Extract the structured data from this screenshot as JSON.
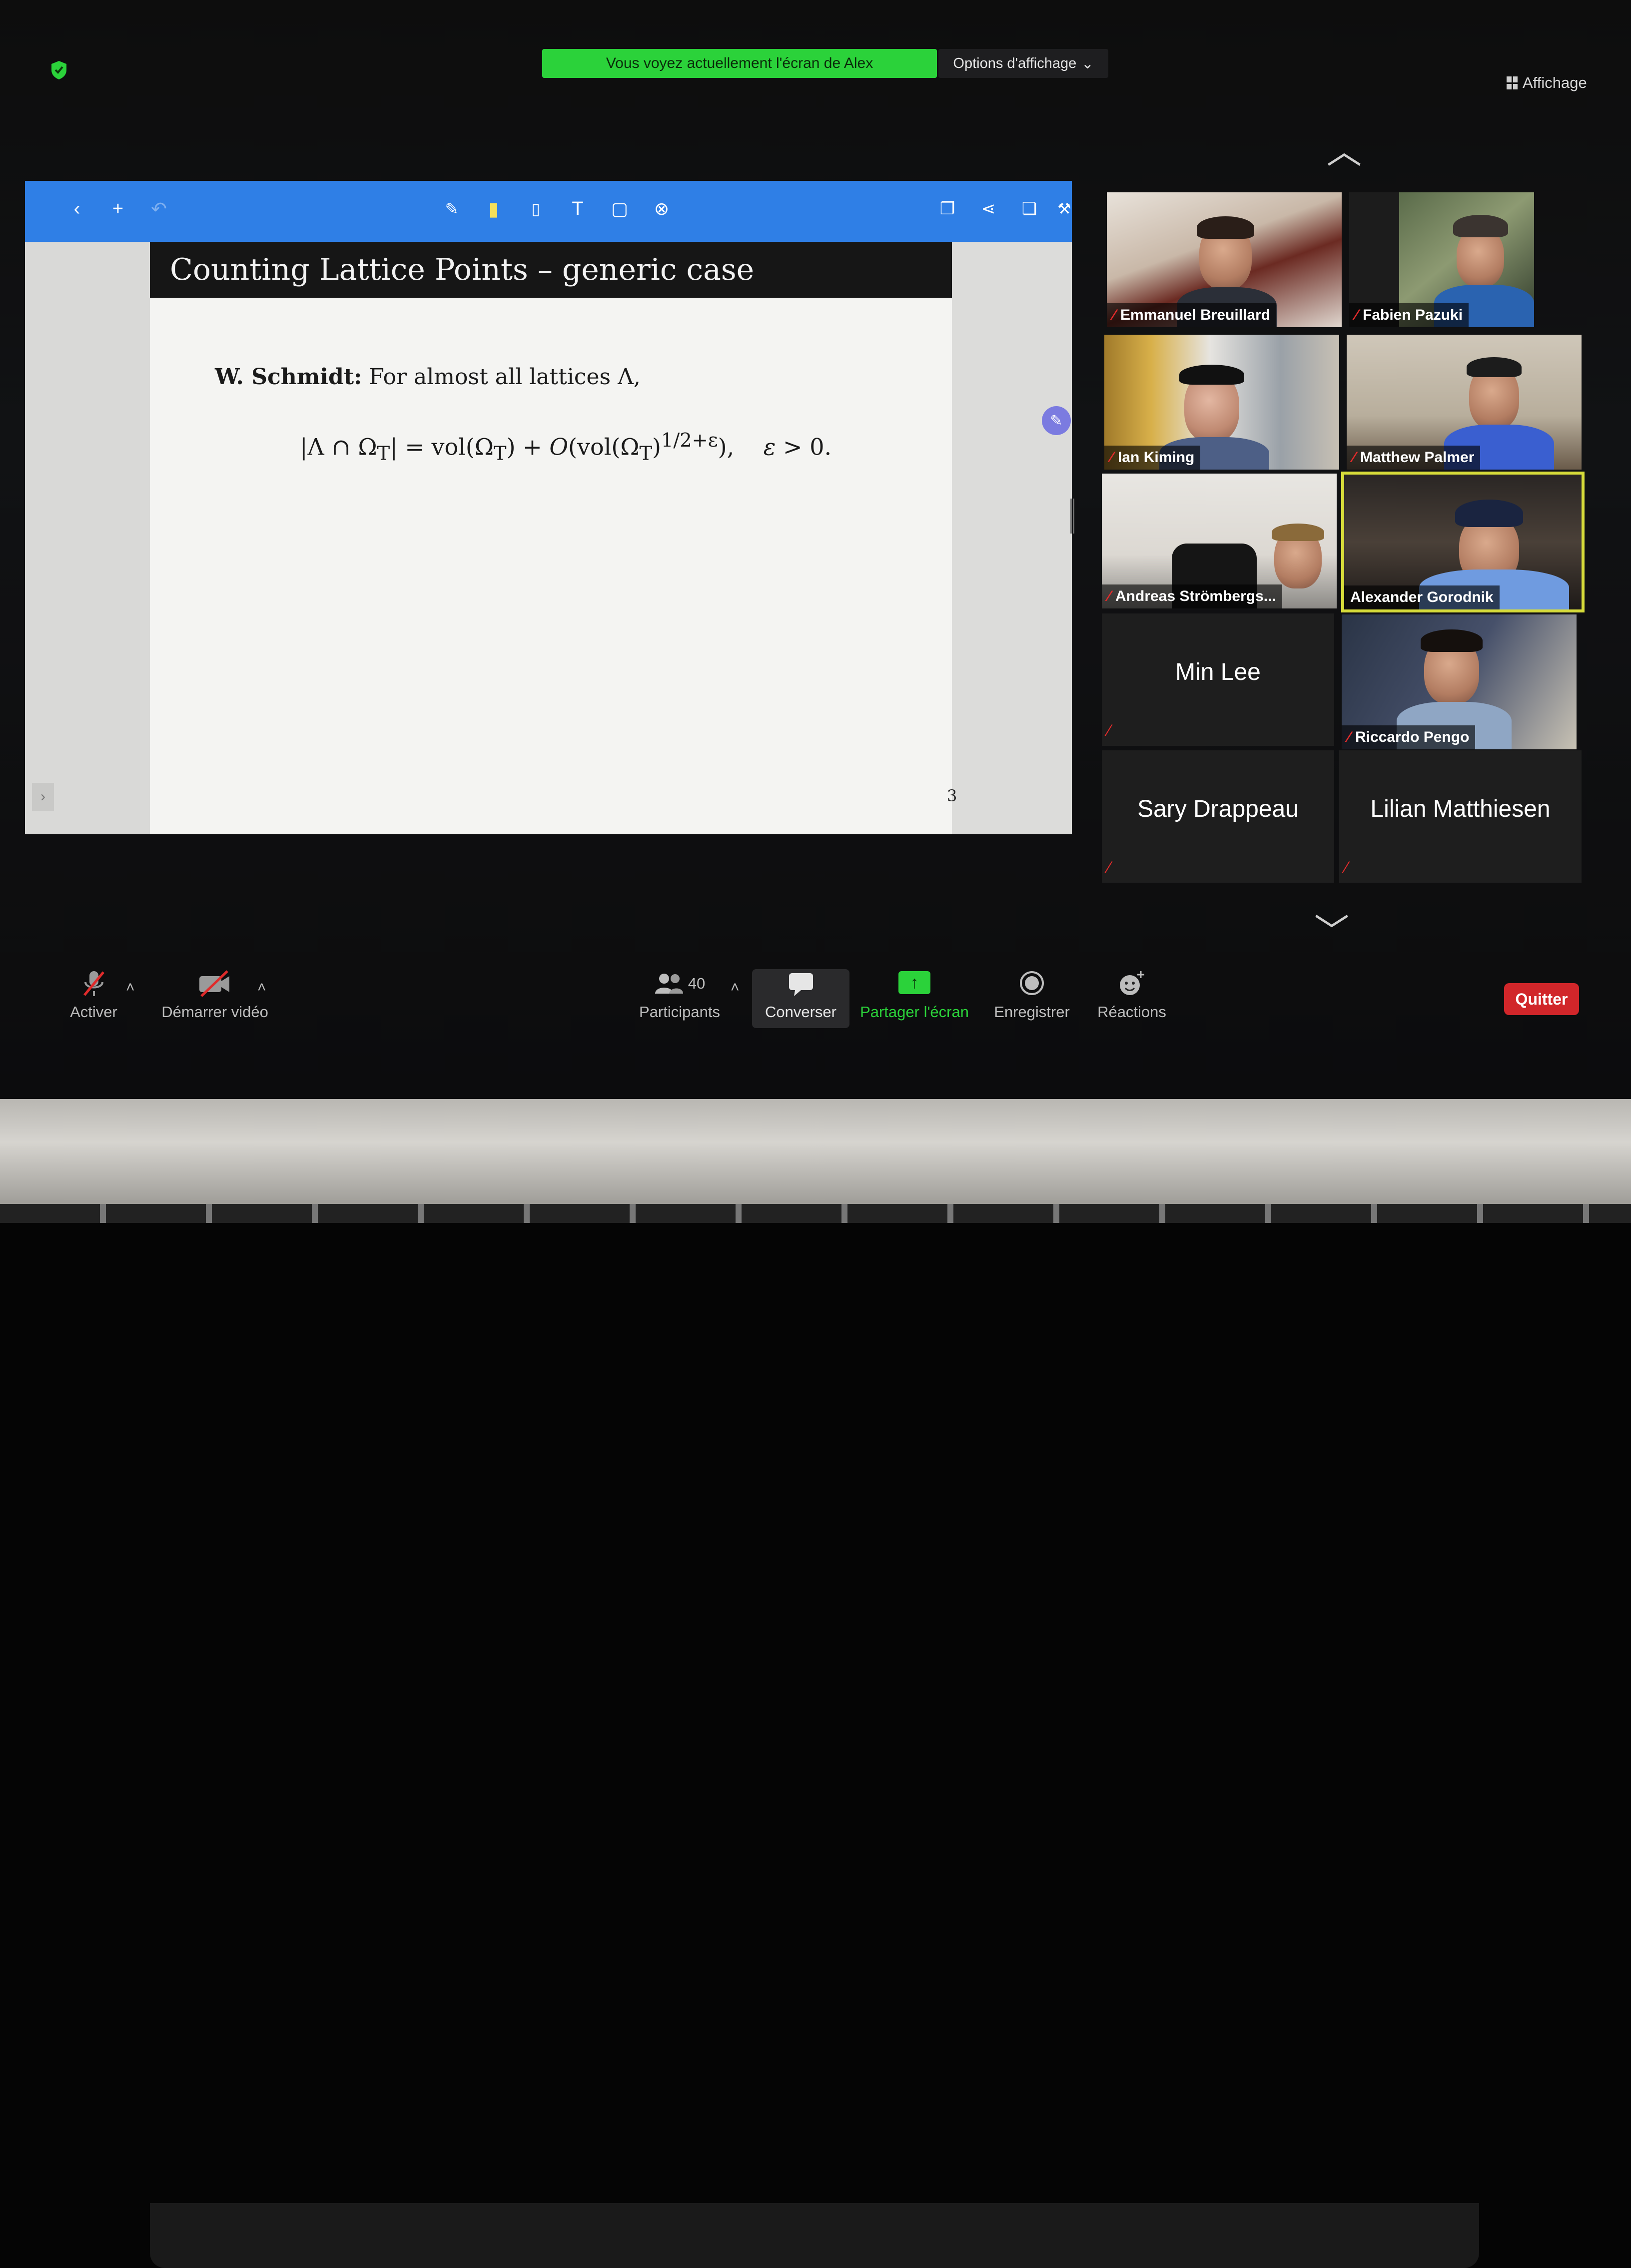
{
  "banner": {
    "viewing_text": "Vous voyez actuellement l'écran de Alex",
    "view_options_label": "Options d'affichage"
  },
  "top_right": {
    "view_label": "Affichage"
  },
  "slide": {
    "title": "Counting Lattice Points – generic case",
    "theorem_author": "W. Schmidt:",
    "theorem_text": "For almost all lattices Λ,",
    "formula": "|Λ ∩ Ω",
    "page_number": "3"
  },
  "participants_gallery": [
    {
      "name": "Emmanuel Breuillard",
      "muted": true,
      "video": true
    },
    {
      "name": "Fabien Pazuki",
      "muted": true,
      "video": true
    },
    {
      "name": "Ian Kiming",
      "muted": true,
      "video": true
    },
    {
      "name": "Matthew Palmer",
      "muted": true,
      "video": true
    },
    {
      "name": "Andreas Strömbergs...",
      "muted": true,
      "video": true
    },
    {
      "name": "Alexander Gorodnik",
      "muted": false,
      "video": true,
      "active_speaker": true
    },
    {
      "name": "Min Lee",
      "muted": true,
      "video": false
    },
    {
      "name": "Riccardo Pengo",
      "muted": true,
      "video": true
    },
    {
      "name": "Sary Drappeau",
      "muted": true,
      "video": false
    },
    {
      "name": "Lilian Matthiesen",
      "muted": true,
      "video": false
    }
  ],
  "toolbar": {
    "mute_label": "Activer",
    "video_label": "Démarrer vidéo",
    "participants_count": "40",
    "participants_label": "Participants",
    "chat_label": "Converser",
    "share_label": "Partager l'écran",
    "record_label": "Enregistrer",
    "reactions_label": "Réactions",
    "quit_label": "Quitter"
  },
  "colors": {
    "banner_green": "#2bd23a",
    "annotation_blue": "#2f7fe6",
    "active_speaker": "#d7dc3a",
    "quit_red": "#d1262a",
    "muted_red": "#e02b2b"
  }
}
